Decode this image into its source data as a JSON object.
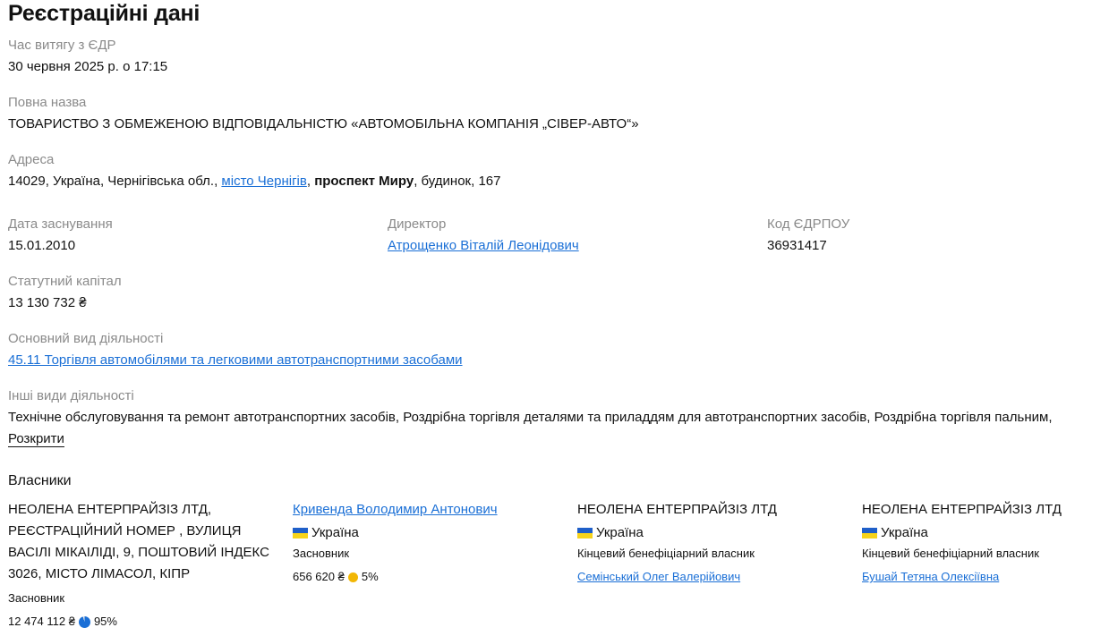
{
  "title": "Реєстраційні дані",
  "extract_time": {
    "label": "Час витягу з ЄДР",
    "value": "30 червня 2025 р. о 17:15"
  },
  "full_name": {
    "label": "Повна назва",
    "value": "ТОВАРИСТВО З ОБМЕЖЕНОЮ ВІДПОВІДАЛЬНІСТЮ «АВТОМОБІЛЬНА КОМПАНІЯ „СІВЕР-АВТО“»"
  },
  "address": {
    "label": "Адреса",
    "part1": "14029, Україна, Чернігівська обл., ",
    "city_link": "місто Чернігів",
    "sep": ", ",
    "street_bold": "проспект Миру",
    "part2": ", будинок, 167"
  },
  "founded": {
    "label": "Дата заснування",
    "value": "15.01.2010"
  },
  "director": {
    "label": "Директор",
    "value": "Атрощенко Віталій Леонідович"
  },
  "edrpou": {
    "label": "Код ЄДРПОУ",
    "value": "36931417"
  },
  "capital": {
    "label": "Статутний капітал",
    "value": "13 130 732 ₴"
  },
  "main_activity": {
    "label": "Основний вид діяльності",
    "value": "45.11 Торгівля автомобілями та легковими автотранспортними засобами"
  },
  "other_activities": {
    "label": "Інші види діяльності",
    "value": "Технічне обслуговування та ремонт автотранспортних засобів, Роздрібна торгівля деталями та приладдям для автотранспортних засобів, Роздрібна торгівля пальним,",
    "expand": "Розкрити"
  },
  "owners": {
    "label": "Власники",
    "items": [
      {
        "name_lines": [
          "НЕОЛЕНА ЕНТЕРПРАЙЗІЗ ЛТД,",
          "РЕЄСТРАЦІЙНИЙ НОМЕР , ВУЛИЦЯ",
          "ВАСІЛІ МІКАІЛІДІ, 9, ПОШТОВИЙ ІНДЕКС",
          "3026, МІСТО ЛІМАСОЛ, КІПР"
        ],
        "role": "Засновник",
        "amount": "12 474 112 ₴",
        "percent": "95%",
        "percent_value": 95,
        "pie_color": "#1a6fd6"
      },
      {
        "name": "Кривенда Володимир Антонович",
        "country": "Україна",
        "role": "Засновник",
        "amount": "656 620 ₴",
        "percent": "5%",
        "percent_value": 5,
        "pie_color": "#f2b705"
      },
      {
        "name": "НЕОЛЕНА ЕНТЕРПРАЙЗІЗ ЛТД",
        "country": "Україна",
        "role": "Кінцевий бенефіціарний власник",
        "beneficiary": "Семінський Олег Валерійович"
      },
      {
        "name": "НЕОЛЕНА ЕНТЕРПРАЙЗІЗ ЛТД",
        "country": "Україна",
        "role": "Кінцевий бенефіціарний власник",
        "beneficiary": "Бушай Тетяна Олексіївна"
      }
    ]
  },
  "colors": {
    "link": "#1a6fd6",
    "label": "#8a8a8a",
    "flag_blue": "#1f5fc9",
    "flag_yellow": "#f7d31a"
  }
}
